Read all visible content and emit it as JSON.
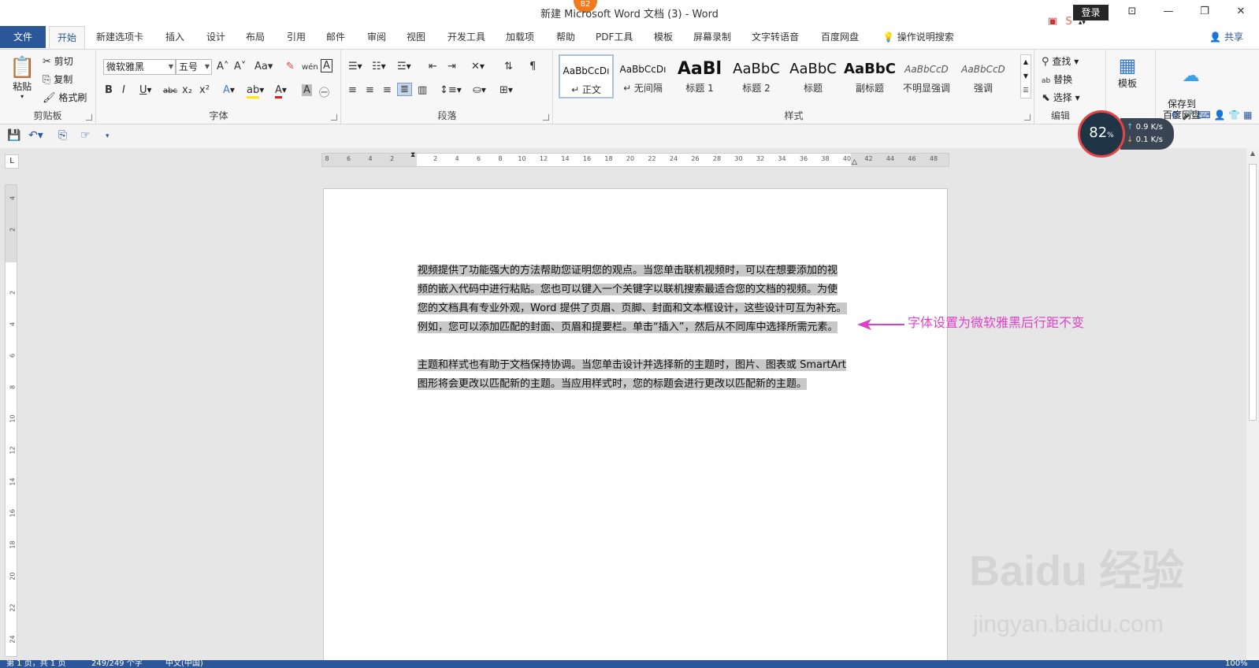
{
  "window": {
    "title": "新建 Microsoft Word 文档 (3)  -  Word",
    "login": "登录",
    "notification_count": "82"
  },
  "tabs": {
    "file": "文件",
    "home": "开始",
    "items": [
      "新建选项卡",
      "插入",
      "设计",
      "布局",
      "引用",
      "邮件",
      "审阅",
      "视图",
      "开发工具",
      "加载项",
      "帮助",
      "PDF工具",
      "模板",
      "屏幕录制",
      "文字转语音",
      "百度网盘"
    ],
    "tell_me": "操作说明搜索",
    "share": "共享"
  },
  "ribbon": {
    "clipboard": {
      "label": "剪贴板",
      "paste": "粘贴",
      "cut": "剪切",
      "copy": "复制",
      "format_painter": "格式刷"
    },
    "font": {
      "label": "字体",
      "font_name": "微软雅黑",
      "font_size": "五号"
    },
    "paragraph": {
      "label": "段落"
    },
    "styles": {
      "label": "样式",
      "items": [
        {
          "preview": "AaBbCcDı",
          "name": "↵ 正文"
        },
        {
          "preview": "AaBbCcDı",
          "name": "↵ 无间隔"
        },
        {
          "preview": "AaBl",
          "name": "标题 1"
        },
        {
          "preview": "AaBbC",
          "name": "标题 2"
        },
        {
          "preview": "AaBbC",
          "name": "标题"
        },
        {
          "preview": "AaBbC",
          "name": "副标题"
        },
        {
          "preview": "AaBbCcD",
          "name": "不明显强调"
        },
        {
          "preview": "AaBbCcD",
          "name": "强调"
        }
      ]
    },
    "editing": {
      "label": "编辑",
      "find": "查找",
      "replace": "替换",
      "select": "选择"
    },
    "template": "模板",
    "save_baidu": "保存到\n百度网盘"
  },
  "document": {
    "paragraph1": "视频提供了功能强大的方法帮助您证明您的观点。当您单击联机视频时，可以在想要添加的视频的嵌入代码中进行粘贴。您也可以键入一个关键字以联机搜索最适合您的文档的视频。为使您的文档具有专业外观，Word 提供了页眉、页脚、封面和文本框设计，这些设计可互为补充。例如，您可以添加匹配的封面、页眉和提要栏。单击“插入”，然后从不同库中选择所需元素。",
    "paragraph2": "主题和样式也有助于文档保持协调。当您单击设计并选择新的主题时，图片、图表或 SmartArt 图形将会更改以匹配新的主题。当应用样式时，您的标题会进行更改以匹配新的主题。"
  },
  "annotation": "字体设置为微软雅黑后行距不变",
  "speed_widget": {
    "percent": "82",
    "unit": "%",
    "up": "0.9 K/s",
    "down": "0.1 K/s"
  },
  "ruler": {
    "h_ticks": [
      "8",
      "6",
      "4",
      "2",
      "",
      "2",
      "4",
      "6",
      "8",
      "10",
      "12",
      "14",
      "16",
      "18",
      "20",
      "22",
      "24",
      "26",
      "28",
      "30",
      "32",
      "34",
      "36",
      "38",
      "40",
      "42",
      "44",
      "46",
      "48"
    ],
    "v_ticks": [
      "4",
      "2",
      "",
      "2",
      "4",
      "6",
      "8",
      "10",
      "12",
      "14",
      "16",
      "18",
      "20",
      "22",
      "24"
    ]
  },
  "statusbar": {
    "page": "第 1 页，共 1 页",
    "words": "249/249 个字",
    "lang": "中文(中国)",
    "zoom": "100%"
  },
  "watermark": {
    "brand": "Baidu 经验",
    "url": "jingyan.baidu.com"
  },
  "colors": {
    "accent": "#2b579a",
    "annotation": "#e040c8",
    "selection": "#c8c8c8"
  }
}
